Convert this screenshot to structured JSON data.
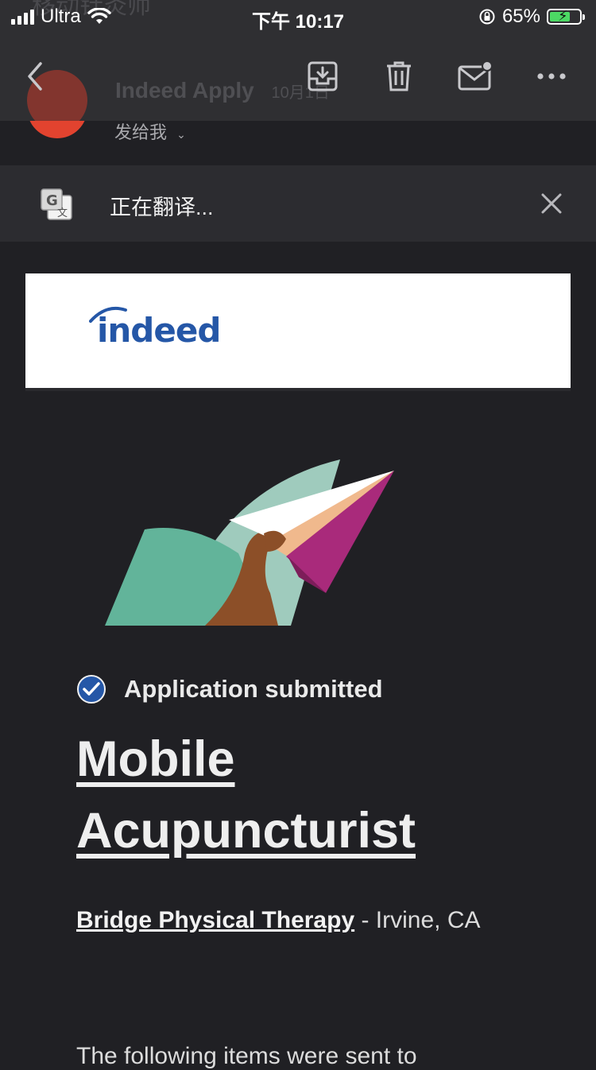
{
  "status_bar": {
    "carrier": "Ultra",
    "time": "下午 10:17",
    "battery": "65%",
    "battery_level": 0.65
  },
  "header": {
    "ghost_subject": "移动针灸师",
    "ghost_sender": "Indeed Apply",
    "ghost_sender_extra": "10月1日"
  },
  "sender": {
    "recipient_label": "发给我"
  },
  "translation_bar": {
    "text": "正在翻译..."
  },
  "email": {
    "logo_text": "indeed",
    "status_text": "Application submitted",
    "job_title_line1": "Mobile",
    "job_title_line2": "Acupuncturist",
    "company": "Bridge Physical Therapy",
    "location": " - Irvine, CA",
    "sent_items_text": "The following items were sent to"
  },
  "icons": {
    "back": "chevron-left-icon",
    "archive": "archive-icon",
    "trash": "trash-icon",
    "mail": "mail-unread-icon",
    "more": "more-horizontal-icon",
    "translate": "translate-icon",
    "close": "close-icon",
    "check": "check-circle-icon"
  },
  "colors": {
    "background": "#202024",
    "toolbar": "#2f2f32",
    "translate_bar": "#2c2c30",
    "indeed_blue": "#2557a7",
    "avatar_red": "#e2432f"
  }
}
